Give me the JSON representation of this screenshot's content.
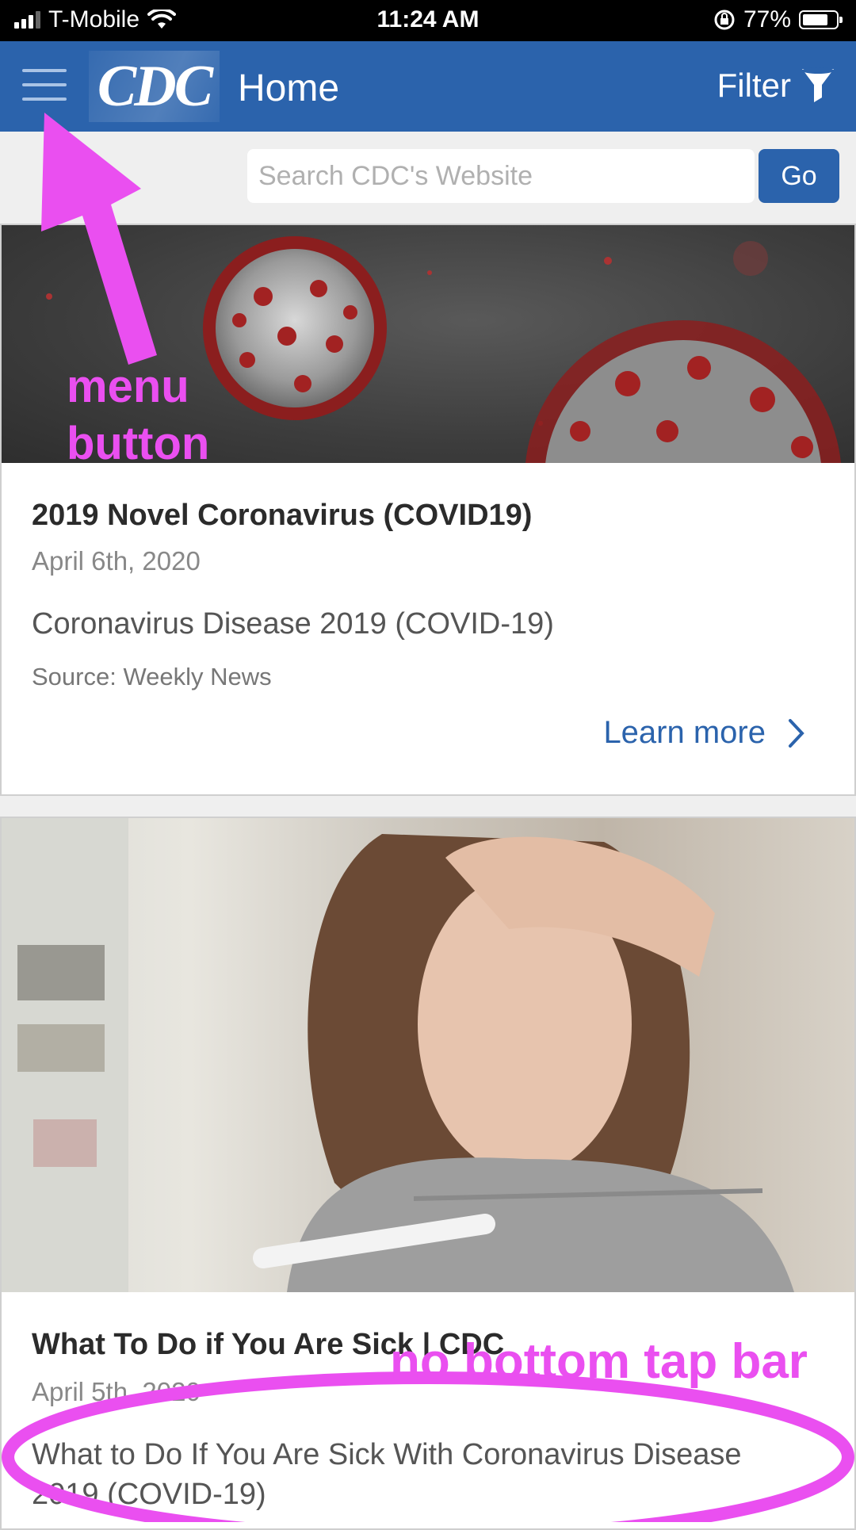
{
  "status_bar": {
    "carrier": "T-Mobile",
    "time": "11:24 AM",
    "battery": "77%",
    "battery_level": 0.77,
    "icons": [
      "signal-icon",
      "wifi-icon",
      "orientation-lock-icon",
      "battery-icon"
    ]
  },
  "header": {
    "logo": "CDC",
    "title": "Home",
    "filter_label": "Filter",
    "colors": {
      "brand": "#2b63ac"
    }
  },
  "search": {
    "placeholder": "Search CDC's Website",
    "value": "",
    "button_label": "Go"
  },
  "cards": [
    {
      "title": "2019 Novel Coronavirus (COVID19)",
      "date": "April 6th, 2020",
      "description": "Coronavirus Disease 2019 (COVID-19)",
      "source": "Source: Weekly News",
      "link_label": "Learn more"
    },
    {
      "title": "What To Do if You Are Sick | CDC",
      "date": "April 5th, 2020",
      "description": "What to Do If You Are Sick With Coronavirus Disease 2019 (COVID-19)"
    }
  ],
  "annotations": {
    "menu_label_line1": "menu",
    "menu_label_line2": "button",
    "tapbar_label": "no bottom tap bar",
    "color": "#ea4ff0"
  }
}
